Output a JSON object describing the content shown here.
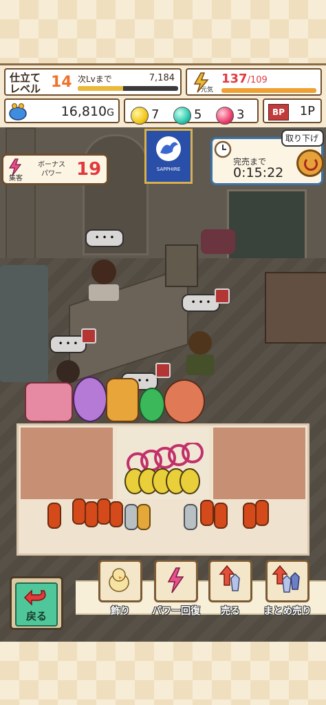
{
  "hud": {
    "level_label": "仕立て\nレベル",
    "level_value": "14",
    "next_level_label": "次Lvまで",
    "next_level_value": "7,184",
    "next_level_progress": 0.45,
    "power_label": "元気",
    "power_current": "137",
    "power_max": "/109",
    "power_progress": 1.0,
    "gold_value": "16,810",
    "gold_unit": "G",
    "gems": [
      {
        "name": "yellow",
        "color": "#f3c61a",
        "count": "7"
      },
      {
        "name": "teal",
        "color": "#2fc7ad",
        "count": "5"
      },
      {
        "name": "pink",
        "color": "#ee3e6d",
        "count": "3"
      }
    ],
    "bp_label": "BP",
    "bp_value": "1P"
  },
  "bonus": {
    "tag": "集客",
    "label": "ボーナス\nパワー",
    "value": "19"
  },
  "timer": {
    "label": "完売まで",
    "value": "0:15:22",
    "button_label": "取り下げ"
  },
  "banner": {
    "text": "SAPPHIRE"
  },
  "actions": {
    "back_label": "戻る",
    "buttons": [
      {
        "label": "飾り",
        "icon": "chick-icon"
      },
      {
        "label": "パワー回復",
        "icon": "lightning-icon"
      },
      {
        "label": "売る",
        "icon": "sell-icon"
      },
      {
        "label": "まとめ売り",
        "icon": "bulk-sell-icon"
      }
    ]
  },
  "colors": {
    "accent_orange": "#f0712a",
    "frame_brown": "#6d4d2d",
    "power_red": "#e2393f"
  }
}
